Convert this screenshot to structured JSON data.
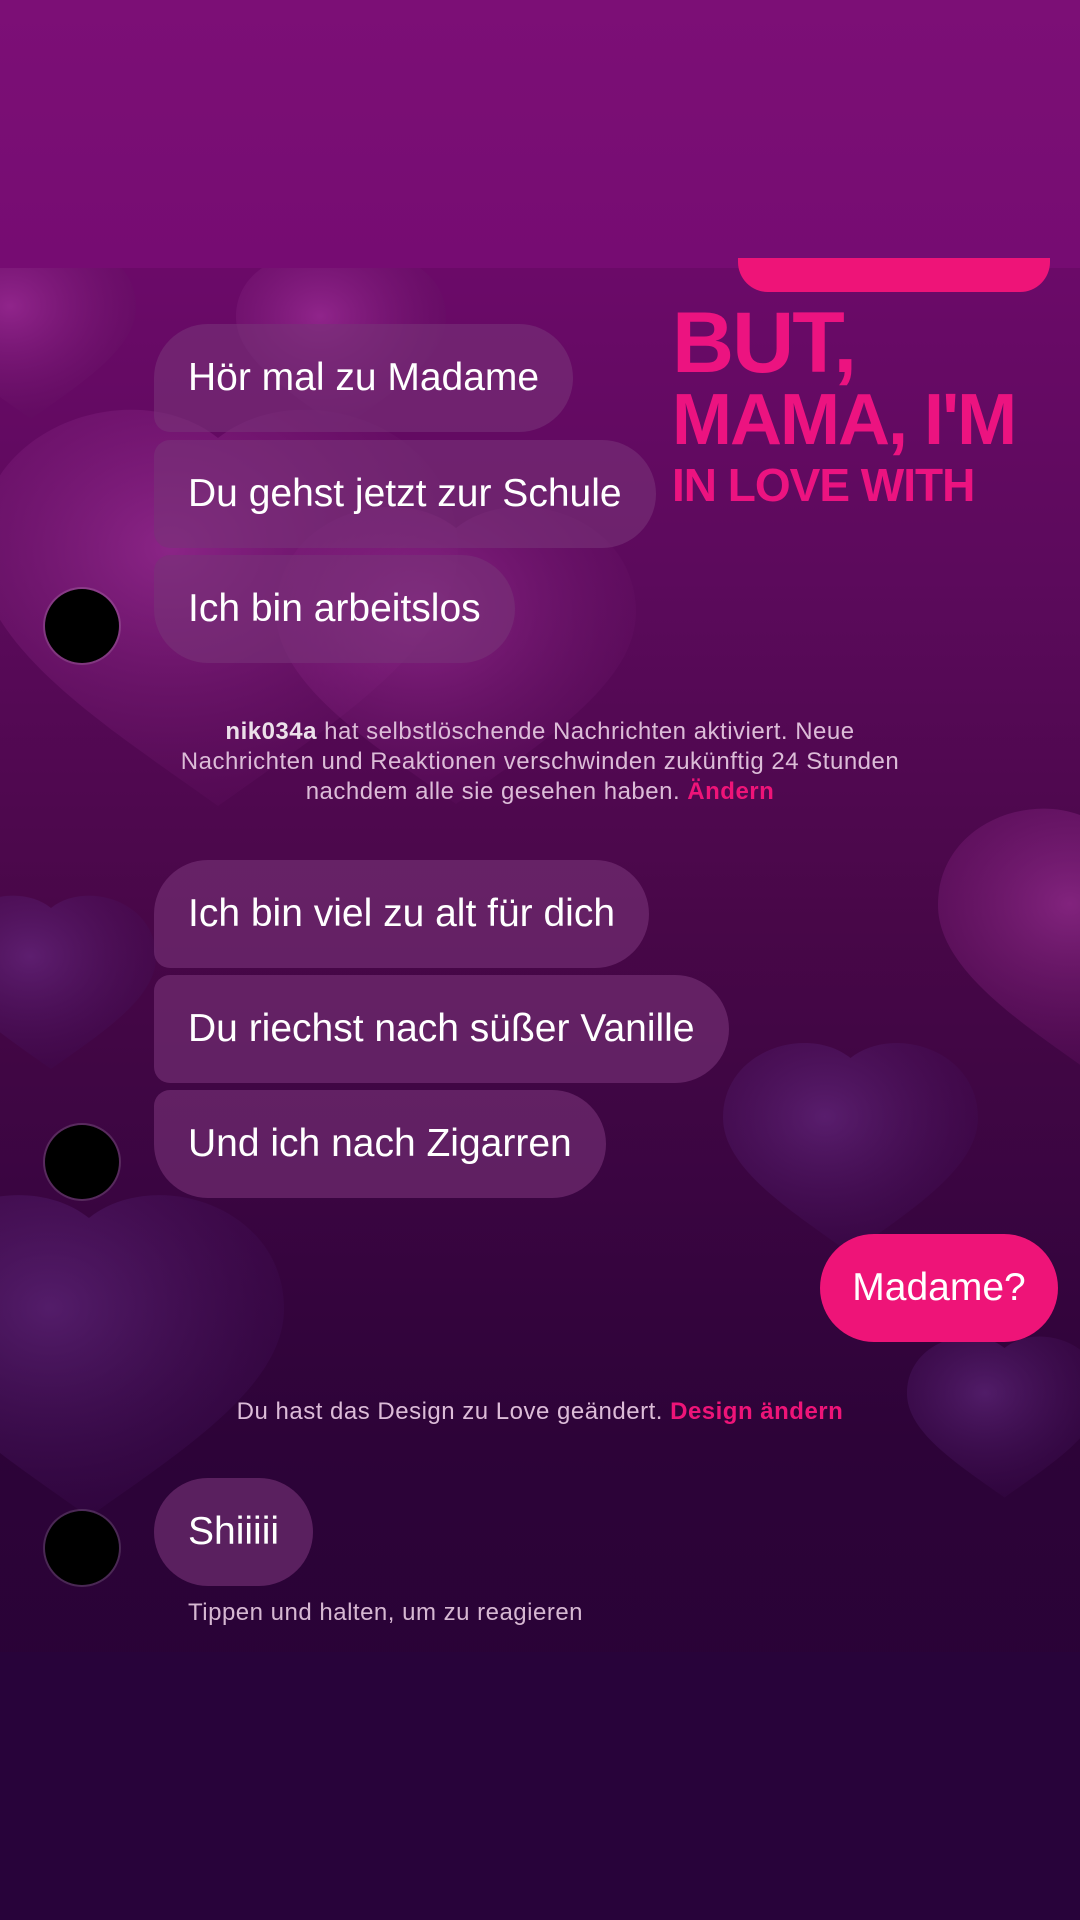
{
  "colors": {
    "accent": "#ee1478",
    "incoming_bubble": "#6e2c6e",
    "background_top": "#7a0e74",
    "background_bottom": "#260235"
  },
  "sticker": {
    "line1": "BUT,",
    "line2": "MAMA, I'M",
    "line3": "IN LOVE WITH"
  },
  "messages_group1": [
    "Hör mal zu Madame",
    "Du gehst jetzt zur Schule",
    "Ich bin arbeitslos"
  ],
  "system_note1": {
    "username": "nik034a",
    "line1_rest": " hat selbstlöschende Nachrichten aktiviert. Neue",
    "line2": "Nachrichten und Reaktionen verschwinden zukünftig 24 Stunden",
    "line3": "nachdem alle sie gesehen haben. ",
    "link": "Ändern"
  },
  "messages_group2": [
    "Ich bin viel zu alt für dich",
    "Du riechst nach süßer Vanille",
    "Und ich nach Zigarren"
  ],
  "outgoing_message": "Madame?",
  "system_note2": {
    "text": "Du hast das Design zu Love geändert. ",
    "link": "Design ändern"
  },
  "message_last": "Shiiiii",
  "hint": "Tippen und halten, um zu reagieren",
  "icons": [
    "avatar"
  ]
}
